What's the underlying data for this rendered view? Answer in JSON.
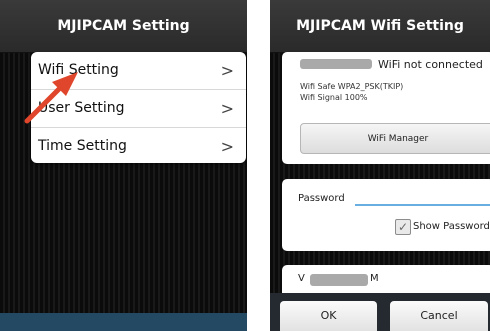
{
  "left_screen": {
    "title": "MJIPCAM  Setting",
    "menu": [
      {
        "label": "Wifi Setting",
        "icon": "chevron-right-icon"
      },
      {
        "label": "User Setting",
        "icon": "chevron-right-icon"
      },
      {
        "label": "Time Setting",
        "icon": "chevron-right-icon"
      }
    ],
    "chevron": ">",
    "annotation_color": "#e0462b"
  },
  "right_screen": {
    "title": "MJIPCAM  Wifi Setting",
    "wifi_status": "WiFi not connected",
    "wifi_safe": "Wifi Safe  WPA2_PSK(TKIP)",
    "wifi_signal": "Wifi Signal  100%",
    "wifi_manager_button": "WiFi Manager",
    "password_label": "Password",
    "password_value": "",
    "show_password_label": "Show Password",
    "show_password_checked": true,
    "check_glyph": "✓",
    "network_name_start": "V",
    "network_name_end": "M",
    "ok_button": "OK",
    "cancel_button": "Cancel"
  }
}
